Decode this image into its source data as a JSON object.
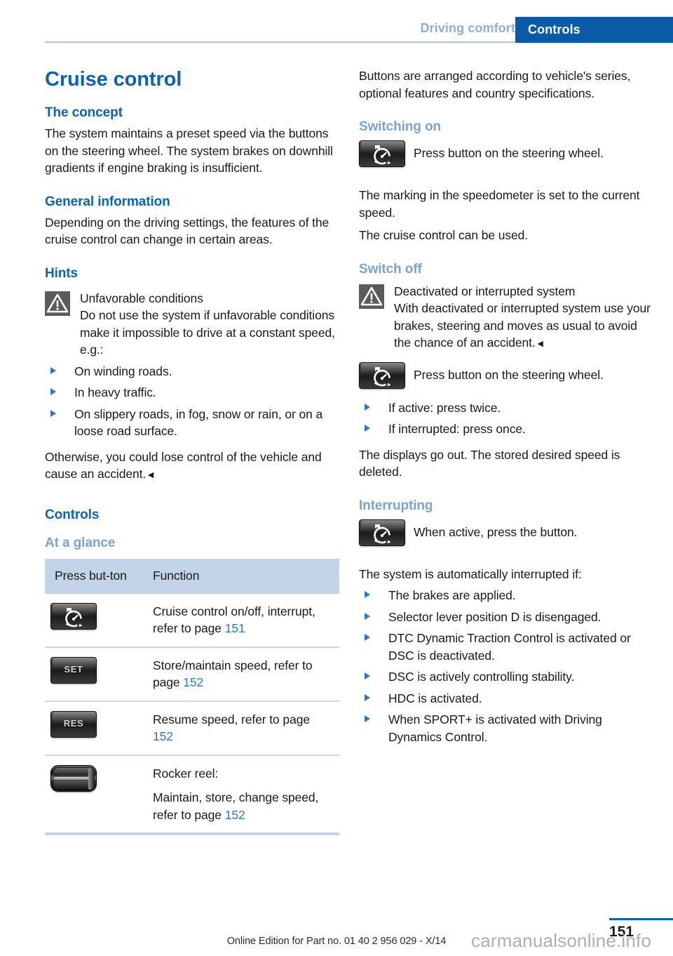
{
  "header": {
    "breadcrumb_inactive": "Driving comfort",
    "tab_active": "Controls"
  },
  "colors": {
    "accent_blue": "#0a63b4",
    "tab_blue": "#0a5aa8",
    "light_blue_heading": "#7ba3cf",
    "breadcrumb_inactive": "#8fb0d6",
    "table_header_bg": "#c3d3e8",
    "link_blue": "#2f78c4",
    "warning_icon_bg": "#5b5b5b"
  },
  "left_column": {
    "title": "Cruise control",
    "concept_heading": "The concept",
    "concept_body": "The system maintains a preset speed via the buttons on the steering wheel. The system brakes on downhill gradients if engine braking is insufficient.",
    "general_heading": "General information",
    "general_body": "Depending on the driving settings, the features of the cruise control can change in certain areas.",
    "hints_heading": "Hints",
    "warning_title": "Unfavorable conditions",
    "warning_body": "Do not use the system if unfavorable conditions make it impossible to drive at a constant speed, e.g.:",
    "warning_bullets": [
      "On winding roads.",
      "In heavy traffic.",
      "On slippery roads, in fog, snow or rain, or on a loose road surface."
    ],
    "warning_closing": "Otherwise, you could lose control of the vehicle and cause an accident.",
    "warning_closing_endmark": "◄",
    "controls_heading": "Controls",
    "at_a_glance_heading": "At a glance",
    "table": {
      "headers": [
        "Press but-\nton",
        "Function"
      ],
      "header_col1": "Press but-ton",
      "header_col2": "Function",
      "rows": [
        {
          "icon": "cruise-control-button-icon",
          "icon_label": "",
          "text": "Cruise control on/off, interrupt, refer to page ",
          "page": "151"
        },
        {
          "icon": "set-button-icon",
          "icon_label": "SET",
          "text": "Store/maintain speed, refer to page ",
          "page": "152"
        },
        {
          "icon": "res-button-icon",
          "icon_label": "RES",
          "text": "Resume speed, refer to page ",
          "page": "152"
        },
        {
          "icon": "rocker-reel-icon",
          "icon_label": "",
          "text": "Rocker reel:",
          "text2": "Maintain, store, change speed, refer to page ",
          "page": "152"
        }
      ]
    }
  },
  "right_column": {
    "intro_body": "Buttons are arranged according to vehicle's series, optional features and country specifications.",
    "switching_on_heading": "Switching on",
    "switching_on_button_text": "Press button on the steering wheel.",
    "switching_on_body1": "The marking in the speedometer is set to the current speed.",
    "switching_on_body2": "The cruise control can be used.",
    "switch_off_heading": "Switch off",
    "switch_off_warning_title": "Deactivated or interrupted system",
    "switch_off_warning_body": "With deactivated or interrupted system use your brakes, steering and moves as usual to avoid the chance of an accident.",
    "switch_off_warning_endmark": "◄",
    "switch_off_button_text": "Press button on the steering wheel.",
    "switch_off_bullets": [
      "If active: press twice.",
      "If interrupted: press once."
    ],
    "switch_off_body": "The displays go out. The stored desired speed is deleted.",
    "interrupting_heading": "Interrupting",
    "interrupting_button_text": "When active, press the button.",
    "interrupting_body": "The system is automatically interrupted if:",
    "interrupting_bullets": [
      "The brakes are applied.",
      "Selector lever position D is disengaged.",
      "DTC Dynamic Traction Control is activated or DSC is deactivated.",
      "DSC is actively controlling stability.",
      "HDC is activated.",
      "When SPORT+ is activated with Driving Dynamics Control."
    ]
  },
  "footer": {
    "page_number": "151",
    "edition": "Online Edition for Part no. 01 40 2 956 029 - X/14",
    "watermark": "carmanualsonline.info"
  }
}
